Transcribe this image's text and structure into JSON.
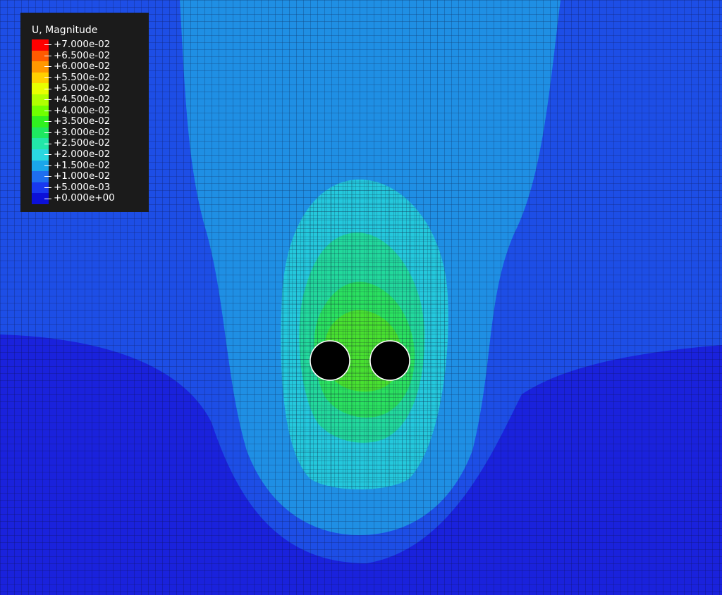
{
  "legend": {
    "title": "U, Magnitude",
    "entries": [
      {
        "label": "+7.000e-02",
        "color": "#ff0000"
      },
      {
        "label": "+6.500e-02",
        "color": "#ff5a00"
      },
      {
        "label": "+6.000e-02",
        "color": "#ff9800"
      },
      {
        "label": "+5.500e-02",
        "color": "#ffd000"
      },
      {
        "label": "+5.000e-02",
        "color": "#e8ff00"
      },
      {
        "label": "+4.500e-02",
        "color": "#b0ff00"
      },
      {
        "label": "+4.000e-02",
        "color": "#70ff00"
      },
      {
        "label": "+3.500e-02",
        "color": "#30f020"
      },
      {
        "label": "+3.000e-02",
        "color": "#1ee860"
      },
      {
        "label": "+2.500e-02",
        "color": "#22e6a8"
      },
      {
        "label": "+2.000e-02",
        "color": "#2ad8e0"
      },
      {
        "label": "+1.500e-02",
        "color": "#1aa6ea"
      },
      {
        "label": "+1.000e-02",
        "color": "#1e6ef0"
      },
      {
        "label": "+5.000e-03",
        "color": "#1838f0"
      },
      {
        "label": "+0.000e+00",
        "color": "#0c10d8"
      }
    ]
  },
  "contour_colors": {
    "band_0": "#1a22dc",
    "band_1": "#1d4ee6",
    "band_2": "#1f8fe4",
    "band_3": "#24c8dc",
    "band_4": "#22d89c",
    "band_5": "#2ae060",
    "band_6": "#48e030"
  },
  "holes": {
    "color": "#000000",
    "outline": "#ffffff"
  }
}
